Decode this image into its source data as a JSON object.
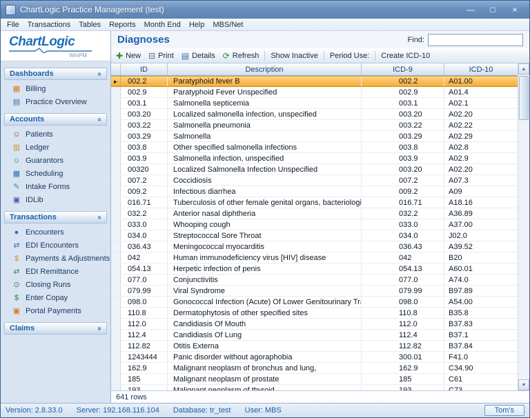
{
  "window": {
    "title": "ChartLogic Practice Management (test)",
    "controls": [
      {
        "name": "minimize-button",
        "glyph": "—"
      },
      {
        "name": "maximize-button",
        "glyph": "□"
      },
      {
        "name": "close-button",
        "glyph": "×"
      }
    ]
  },
  "menu": [
    "File",
    "Transactions",
    "Tables",
    "Reports",
    "Month End",
    "Help",
    "MBS/Net"
  ],
  "sidebar": {
    "logo": {
      "brand": "ChartLogic",
      "sub": "WinPM"
    },
    "sections": [
      {
        "label": "Dashboards",
        "collapsed": false,
        "items": [
          {
            "label": "Billing",
            "icon": "billing-icon",
            "glyph": "▦",
            "color": "#d97b1e"
          },
          {
            "label": "Practice Overview",
            "icon": "practice-overview-icon",
            "glyph": "▤",
            "color": "#3a6ea5"
          }
        ]
      },
      {
        "label": "Accounts",
        "collapsed": false,
        "items": [
          {
            "label": "Patients",
            "icon": "patients-icon",
            "glyph": "☺",
            "color": "#b03a2e"
          },
          {
            "label": "Ledger",
            "icon": "ledger-icon",
            "glyph": "▥",
            "color": "#c8952a"
          },
          {
            "label": "Guarantors",
            "icon": "guarantors-icon",
            "glyph": "☺",
            "color": "#2e8b57"
          },
          {
            "label": "Scheduling",
            "icon": "scheduling-icon",
            "glyph": "▦",
            "color": "#2e6db4"
          },
          {
            "label": "Intake Forms",
            "icon": "intake-forms-icon",
            "glyph": "✎",
            "color": "#2e8b8b"
          },
          {
            "label": "IDLib",
            "icon": "idlib-icon",
            "glyph": "▣",
            "color": "#4a5ab0"
          }
        ]
      },
      {
        "label": "Transactions",
        "collapsed": false,
        "items": [
          {
            "label": "Encounters",
            "icon": "encounters-icon",
            "glyph": "●",
            "color": "#2e6db4"
          },
          {
            "label": "EDI Encounters",
            "icon": "edi-encounters-icon",
            "glyph": "⇄",
            "color": "#2e6db4"
          },
          {
            "label": "Payments & Adjustments",
            "icon": "payments-adjustments-icon",
            "glyph": "$",
            "color": "#c8952a"
          },
          {
            "label": "EDI Remittance",
            "icon": "edi-remittance-icon",
            "glyph": "⇄",
            "color": "#2e8b57"
          },
          {
            "label": "Closing Runs",
            "icon": "closing-runs-icon",
            "glyph": "⊙",
            "color": "#5b6b85"
          },
          {
            "label": "Enter Copay",
            "icon": "enter-copay-icon",
            "glyph": "$",
            "color": "#2e8b2e"
          },
          {
            "label": "Portal Payments",
            "icon": "portal-payments-icon",
            "glyph": "▣",
            "color": "#d97b1e"
          }
        ]
      },
      {
        "label": "Claims",
        "collapsed": true,
        "items": []
      }
    ]
  },
  "main": {
    "title": "Diagnoses",
    "find_label": "Find:",
    "find_value": "",
    "toolbar": [
      {
        "label": "New",
        "icon": "new-icon",
        "glyph": "✚",
        "color": "#2e8b2e"
      },
      {
        "label": "Print",
        "icon": "print-icon",
        "glyph": "⊟",
        "color": "#5b6b85"
      },
      {
        "label": "Details",
        "icon": "details-icon",
        "glyph": "▤",
        "color": "#3a6ea5"
      },
      {
        "label": "Refresh",
        "icon": "refresh-icon",
        "glyph": "⟳",
        "color": "#2e8b2e",
        "sep": true
      },
      {
        "label": "Show Inactive",
        "sep": true
      },
      {
        "label": "Period Use:",
        "sep": true
      },
      {
        "label": "Create ICD-10"
      }
    ],
    "grid": {
      "columns": [
        "ID",
        "Description",
        "ICD-9",
        "ICD-10"
      ],
      "selected_row": 0,
      "rows": [
        [
          "002.2",
          "Paratyphoid fever B",
          "002.2",
          "A01.00"
        ],
        [
          "002.9",
          "Paratyphoid Fever Unspecified",
          "002.9",
          "A01.4"
        ],
        [
          "003.1",
          "Salmonella septicemia",
          "003.1",
          "A02.1"
        ],
        [
          "003.20",
          "Localized salmonella infection, unspecified",
          "003.20",
          "A02.20"
        ],
        [
          "003.22",
          "Salmonella pneumonia",
          "003.22",
          "A02.22"
        ],
        [
          "003.29",
          "Salmonella",
          "003.29",
          "A02.29"
        ],
        [
          "003.8",
          "Other specified salmonella infections",
          "003.8",
          "A02.8"
        ],
        [
          "003.9",
          "Salmonella infection, unspecified",
          "003.9",
          "A02.9"
        ],
        [
          "00320",
          "Localized Salmonella Infection Unspecified",
          "003.20",
          "A02.20"
        ],
        [
          "007.2",
          "Coccidiosis",
          "007.2",
          "A07.3"
        ],
        [
          "009.2",
          "Infectious diarrhea",
          "009.2",
          "A09"
        ],
        [
          "016.71",
          "Tuberculosis of other female genital organs, bacteriological",
          "016.71",
          "A18.16"
        ],
        [
          "032.2",
          "Anterior nasal diphtheria",
          "032.2",
          "A36.89"
        ],
        [
          "033.0",
          "Whooping cough",
          "033.0",
          "A37.00"
        ],
        [
          "034.0",
          "Streptococcal Sore Throat",
          "034.0",
          "J02.0"
        ],
        [
          "036.43",
          "Meningococcal myocarditis",
          "036.43",
          "A39.52"
        ],
        [
          "042",
          "Human immunodeficiency virus [HIV] disease",
          "042",
          "B20"
        ],
        [
          "054.13",
          "Herpetic infection of penis",
          "054.13",
          "A60.01"
        ],
        [
          "077.0",
          "Conjunctivitis",
          "077.0",
          "A74.0"
        ],
        [
          "079.99",
          "Viral Syndrome",
          "079.99",
          "B97.89"
        ],
        [
          "098.0",
          "Gonococcal Infection (Acute) Of Lower Genitourinary Tract",
          "098.0",
          "A54.00"
        ],
        [
          "110.8",
          "Dermatophytosis of other specified sites",
          "110.8",
          "B35.8"
        ],
        [
          "112.0",
          "Candidiasis Of Mouth",
          "112.0",
          "B37.83"
        ],
        [
          "112.4",
          "Candidiasis Of Lung",
          "112.4",
          "B37.1"
        ],
        [
          "112.82",
          "Otitis Externa",
          "112.82",
          "B37.84"
        ],
        [
          "1243444",
          "Panic disorder without agoraphobia",
          "300.01",
          "F41.0"
        ],
        [
          "162.9",
          "Malignant neoplasm of bronchus and lung,",
          "162.9",
          "C34.90"
        ],
        [
          "185",
          "Malignant neoplasm of prostate",
          "185",
          "C61"
        ],
        [
          "193",
          "Malignant neoplasm of thyroid",
          "193",
          "C73"
        ]
      ],
      "footer": "641 rows"
    },
    "scrollbar": {
      "up": "▲",
      "down": "▼"
    }
  },
  "statusbar": {
    "fields": [
      {
        "name": "version",
        "text": "Version: 2.8.33.0"
      },
      {
        "name": "server",
        "text": "Server: 192.168.116.104"
      },
      {
        "name": "database",
        "text": "Database: tr_test"
      },
      {
        "name": "user",
        "text": "User: MBS"
      }
    ],
    "badge": "Tom's"
  },
  "colors": {
    "titlebar_blue": "#6990bd",
    "accent_blue": "#1b5fae",
    "selected_row_orange": "#f6ab35"
  }
}
